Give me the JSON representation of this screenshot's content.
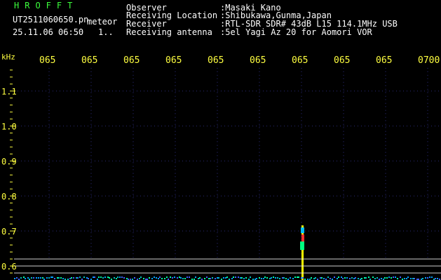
{
  "header": {
    "brand": "HROFFT",
    "filename": "UT2511060650.pn",
    "meteor_label": "meteor",
    "datetime": "25.11.06 06:50",
    "counter": "1..",
    "fields": [
      {
        "label": "Observer",
        "value": ":Masaki Kano"
      },
      {
        "label": "Receiving Location",
        "value": ":Shibukawa,Gunma,Japan"
      },
      {
        "label": "Receiver",
        "value": ":RTL-SDR SDR# 43dB L15 114.1MHz USB"
      },
      {
        "label": "Receiving antenna",
        "value": ":5el Yagi Az 20 for Aomori VOR"
      }
    ]
  },
  "spectrogram": {
    "y_unit": "kHz",
    "x_ticks": [
      "065",
      "065",
      "065",
      "065",
      "065",
      "065",
      "065",
      "065",
      "065",
      "0700"
    ],
    "y_ticks": [
      "1.1",
      "1.0",
      "0.9",
      "0.8",
      "0.7",
      "0.6"
    ],
    "colors": {
      "axis": "#ffff40",
      "grid": "#2a2a7a",
      "text": "#ffffff",
      "brand": "#3cff3c"
    }
  }
}
